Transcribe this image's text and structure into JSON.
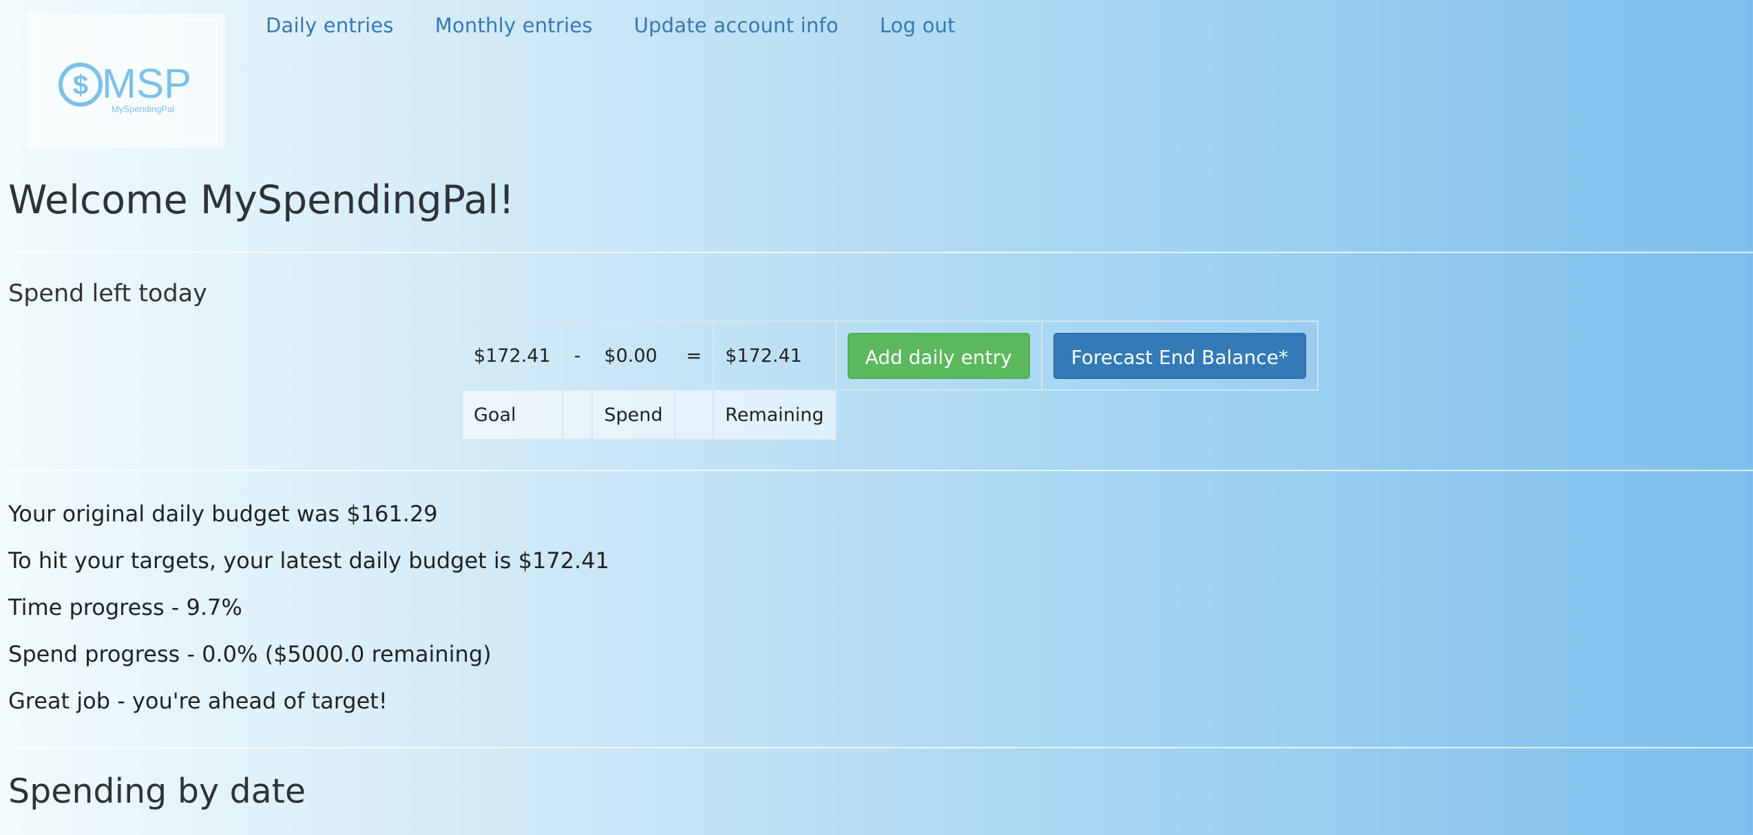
{
  "logo": {
    "brand": "MSP",
    "tagline": "MySpendingPal",
    "icon": "dollar-coin-icon",
    "color": "#7cc0ea"
  },
  "nav": {
    "daily": "Daily entries",
    "monthly": "Monthly entries",
    "account": "Update account info",
    "logout": "Log out"
  },
  "welcome": "Welcome MySpendingPal!",
  "spend_left_label": "Spend left today",
  "summary": {
    "goal_value": "$172.41",
    "minus": "-",
    "spend_value": "$0.00",
    "equals": "=",
    "remaining_value": "$172.41",
    "goal_label": "Goal",
    "spend_label": "Spend",
    "remaining_label": "Remaining"
  },
  "buttons": {
    "add_daily": "Add daily entry",
    "forecast": "Forecast End Balance*"
  },
  "stats": {
    "original_budget": "Your original daily budget was $161.29",
    "latest_budget": "To hit your targets, your latest daily budget is $172.41",
    "time_progress": "Time progress - 9.7%",
    "spend_progress": "Spend progress - 0.0% ($5000.0 remaining)",
    "message": "Great job - you're ahead of target!"
  },
  "section_title": "Spending by date",
  "colors": {
    "accent_link": "#3777b5",
    "success": "#5cb85c",
    "primary": "#337ab7"
  }
}
